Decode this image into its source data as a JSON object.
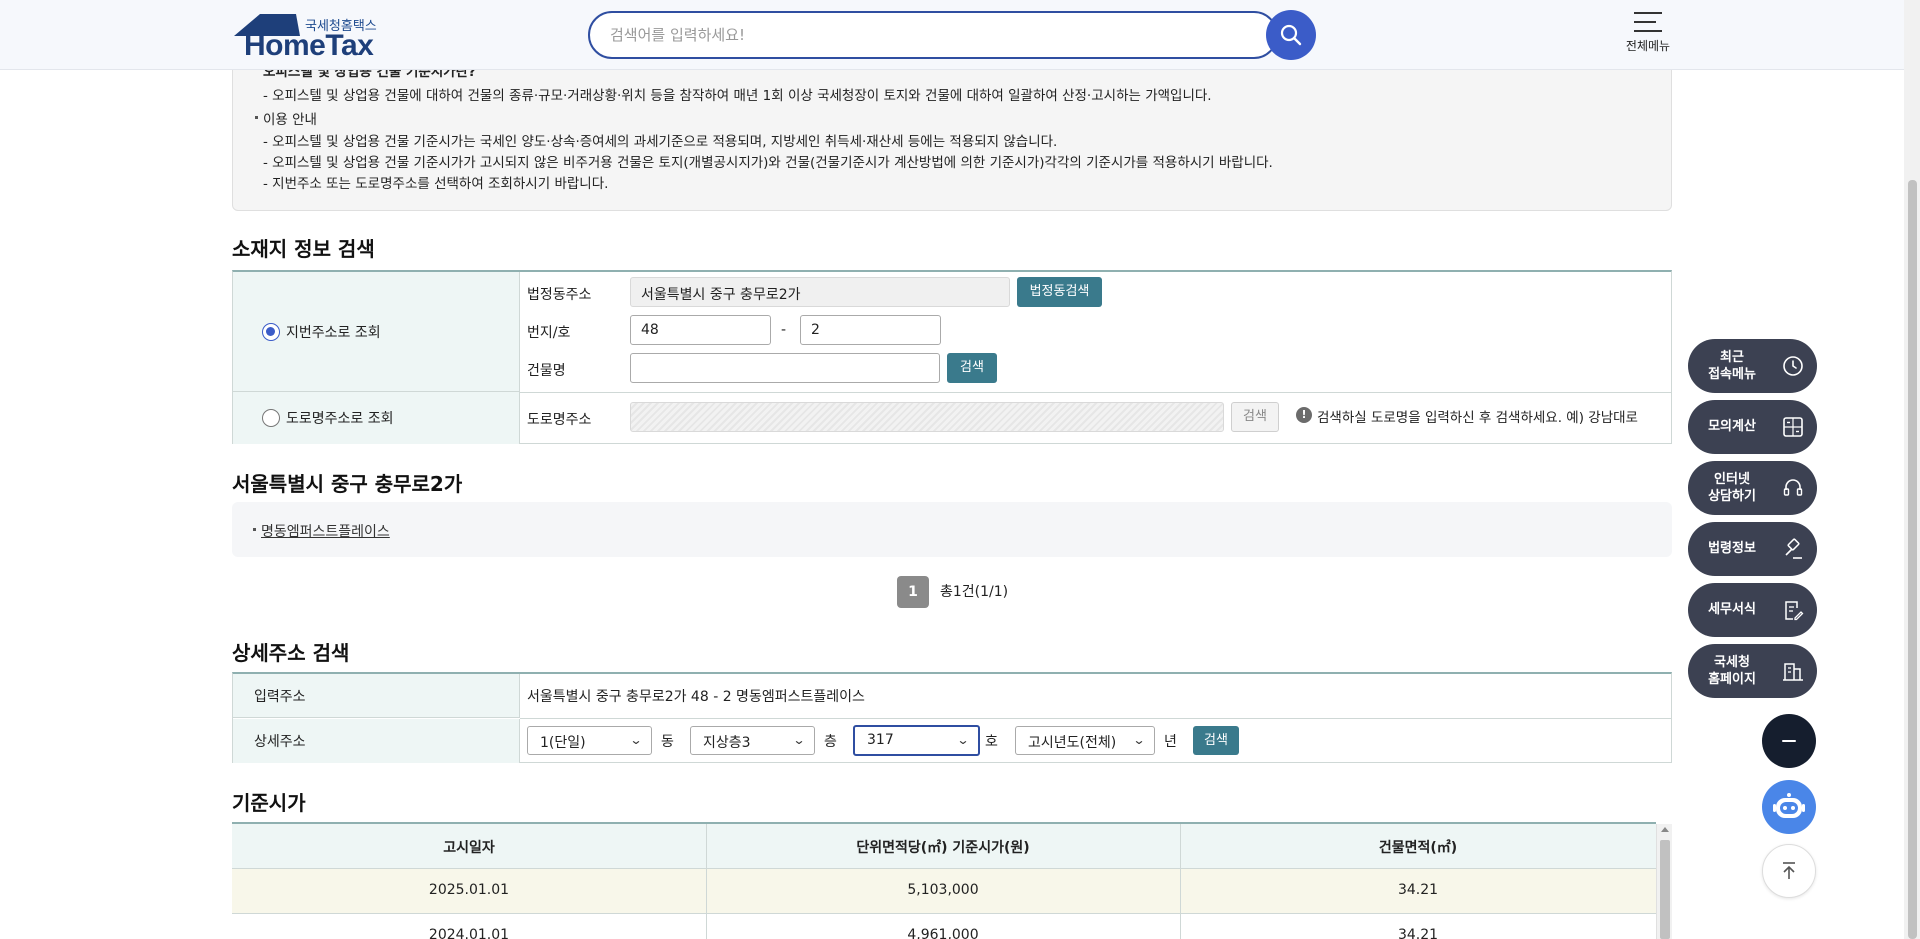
{
  "header": {
    "logo_sub": "국세청홈택스",
    "logo_main": "HomeTax",
    "search_placeholder": "검색어를 입력하세요!",
    "menu_label": "전체메뉴"
  },
  "info": {
    "line0": "오피스텔 및 상업용 건물 기준시가란?",
    "line1": "- 오피스텔 및 상업용 건물에 대하여 건물의 종류·규모·거래상황·위치 등을 참작하여 매년 1회 이상 국세청장이 토지와 건물에 대하여 일괄하여 산정·고시하는 가액입니다.",
    "heading2": "이용 안내",
    "line2": "- 오피스텔 및 상업용 건물 기준시가는 국세인 양도·상속·증여세의 과세기준으로 적용되며, 지방세인 취득세·재산세 등에는 적용되지 않습니다.",
    "line3": "- 오피스텔 및 상업용 건물 기준시가가 고시되지 않은 비주거용 건물은 토지(개별공시지가)와 건물(건물기준시가 계산방법에 의한 기준시가)각각의 기준시가를 적용하시기 바랍니다.",
    "line4": "- 지번주소 또는 도로명주소를 선택하여 조회하시기 바랍니다."
  },
  "location": {
    "title": "소재지 정보 검색",
    "radio_jibun": "지번주소로 조회",
    "radio_road": "도로명주소로 조회",
    "legal_label": "법정동주소",
    "legal_value": "서울특별시 중구 충무로2가",
    "legal_btn": "법정동검색",
    "bunji_label": "번지/호",
    "bunji_main": "48",
    "bunji_dash": "-",
    "bunji_sub": "2",
    "bldg_label": "건물명",
    "bldg_value": "",
    "search_btn": "검색",
    "road_label": "도로명주소",
    "road_btn": "검색",
    "road_hint": "검색하실 도로명을 입력하신 후 검색하세요. 예) 강남대로"
  },
  "result": {
    "title": "서울특별시 중구 충무로2가",
    "item": "명동엠퍼스트플레이스",
    "page": "1",
    "total": "총1건(1/1)"
  },
  "detail": {
    "title": "상세주소 검색",
    "input_label": "입력주소",
    "input_value": "서울특별시 중구 충무로2가 48 - 2 명동엠퍼스트플레이스",
    "detail_label": "상세주소",
    "dong_value": "1(단일)",
    "dong_unit": "동",
    "floor_value": "지상층3",
    "floor_unit": "층",
    "ho_value": "317",
    "ho_unit": "호",
    "year_value": "고시년도(전체)",
    "year_unit": "년",
    "search_btn": "검색"
  },
  "price": {
    "title": "기준시가",
    "columns": [
      "고시일자",
      "단위면적당(㎡) 기준시가(원)",
      "건물면적(㎡)"
    ],
    "rows": [
      [
        "2025.01.01",
        "5,103,000",
        "34.21"
      ],
      [
        "2024.01.01",
        "4,961,000",
        "34.21"
      ]
    ]
  },
  "floating": {
    "recent": "최근\n접속메뉴",
    "calc": "모의계산",
    "consult": "인터넷\n상담하기",
    "law": "법령정보",
    "forms": "세무서식",
    "nts": "국세청\n홈페이지"
  }
}
